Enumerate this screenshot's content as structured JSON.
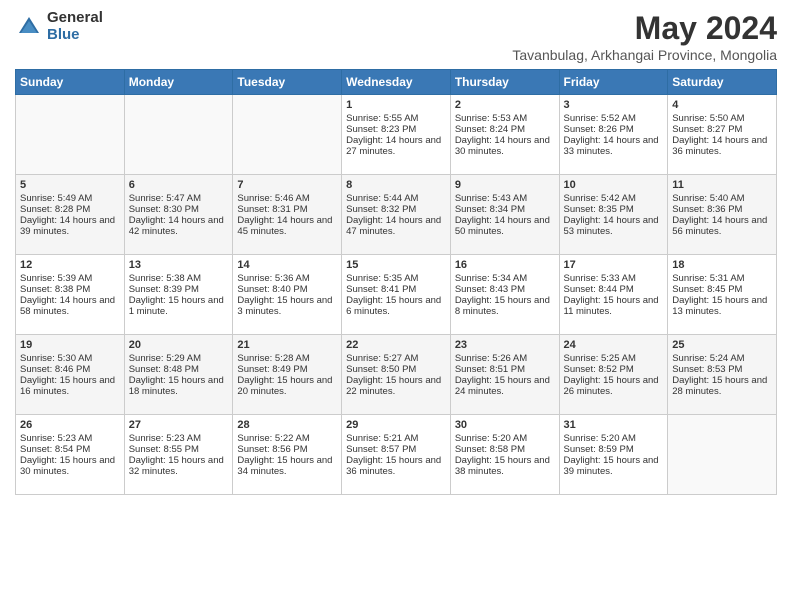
{
  "logo": {
    "general": "General",
    "blue": "Blue"
  },
  "title": "May 2024",
  "subtitle": "Tavanbulag, Arkhangai Province, Mongolia",
  "days_of_week": [
    "Sunday",
    "Monday",
    "Tuesday",
    "Wednesday",
    "Thursday",
    "Friday",
    "Saturday"
  ],
  "weeks": [
    [
      {
        "day": "",
        "info": ""
      },
      {
        "day": "",
        "info": ""
      },
      {
        "day": "",
        "info": ""
      },
      {
        "day": "1",
        "info": "Sunrise: 5:55 AM\nSunset: 8:23 PM\nDaylight: 14 hours and 27 minutes."
      },
      {
        "day": "2",
        "info": "Sunrise: 5:53 AM\nSunset: 8:24 PM\nDaylight: 14 hours and 30 minutes."
      },
      {
        "day": "3",
        "info": "Sunrise: 5:52 AM\nSunset: 8:26 PM\nDaylight: 14 hours and 33 minutes."
      },
      {
        "day": "4",
        "info": "Sunrise: 5:50 AM\nSunset: 8:27 PM\nDaylight: 14 hours and 36 minutes."
      }
    ],
    [
      {
        "day": "5",
        "info": "Sunrise: 5:49 AM\nSunset: 8:28 PM\nDaylight: 14 hours and 39 minutes."
      },
      {
        "day": "6",
        "info": "Sunrise: 5:47 AM\nSunset: 8:30 PM\nDaylight: 14 hours and 42 minutes."
      },
      {
        "day": "7",
        "info": "Sunrise: 5:46 AM\nSunset: 8:31 PM\nDaylight: 14 hours and 45 minutes."
      },
      {
        "day": "8",
        "info": "Sunrise: 5:44 AM\nSunset: 8:32 PM\nDaylight: 14 hours and 47 minutes."
      },
      {
        "day": "9",
        "info": "Sunrise: 5:43 AM\nSunset: 8:34 PM\nDaylight: 14 hours and 50 minutes."
      },
      {
        "day": "10",
        "info": "Sunrise: 5:42 AM\nSunset: 8:35 PM\nDaylight: 14 hours and 53 minutes."
      },
      {
        "day": "11",
        "info": "Sunrise: 5:40 AM\nSunset: 8:36 PM\nDaylight: 14 hours and 56 minutes."
      }
    ],
    [
      {
        "day": "12",
        "info": "Sunrise: 5:39 AM\nSunset: 8:38 PM\nDaylight: 14 hours and 58 minutes."
      },
      {
        "day": "13",
        "info": "Sunrise: 5:38 AM\nSunset: 8:39 PM\nDaylight: 15 hours and 1 minute."
      },
      {
        "day": "14",
        "info": "Sunrise: 5:36 AM\nSunset: 8:40 PM\nDaylight: 15 hours and 3 minutes."
      },
      {
        "day": "15",
        "info": "Sunrise: 5:35 AM\nSunset: 8:41 PM\nDaylight: 15 hours and 6 minutes."
      },
      {
        "day": "16",
        "info": "Sunrise: 5:34 AM\nSunset: 8:43 PM\nDaylight: 15 hours and 8 minutes."
      },
      {
        "day": "17",
        "info": "Sunrise: 5:33 AM\nSunset: 8:44 PM\nDaylight: 15 hours and 11 minutes."
      },
      {
        "day": "18",
        "info": "Sunrise: 5:31 AM\nSunset: 8:45 PM\nDaylight: 15 hours and 13 minutes."
      }
    ],
    [
      {
        "day": "19",
        "info": "Sunrise: 5:30 AM\nSunset: 8:46 PM\nDaylight: 15 hours and 16 minutes."
      },
      {
        "day": "20",
        "info": "Sunrise: 5:29 AM\nSunset: 8:48 PM\nDaylight: 15 hours and 18 minutes."
      },
      {
        "day": "21",
        "info": "Sunrise: 5:28 AM\nSunset: 8:49 PM\nDaylight: 15 hours and 20 minutes."
      },
      {
        "day": "22",
        "info": "Sunrise: 5:27 AM\nSunset: 8:50 PM\nDaylight: 15 hours and 22 minutes."
      },
      {
        "day": "23",
        "info": "Sunrise: 5:26 AM\nSunset: 8:51 PM\nDaylight: 15 hours and 24 minutes."
      },
      {
        "day": "24",
        "info": "Sunrise: 5:25 AM\nSunset: 8:52 PM\nDaylight: 15 hours and 26 minutes."
      },
      {
        "day": "25",
        "info": "Sunrise: 5:24 AM\nSunset: 8:53 PM\nDaylight: 15 hours and 28 minutes."
      }
    ],
    [
      {
        "day": "26",
        "info": "Sunrise: 5:23 AM\nSunset: 8:54 PM\nDaylight: 15 hours and 30 minutes."
      },
      {
        "day": "27",
        "info": "Sunrise: 5:23 AM\nSunset: 8:55 PM\nDaylight: 15 hours and 32 minutes."
      },
      {
        "day": "28",
        "info": "Sunrise: 5:22 AM\nSunset: 8:56 PM\nDaylight: 15 hours and 34 minutes."
      },
      {
        "day": "29",
        "info": "Sunrise: 5:21 AM\nSunset: 8:57 PM\nDaylight: 15 hours and 36 minutes."
      },
      {
        "day": "30",
        "info": "Sunrise: 5:20 AM\nSunset: 8:58 PM\nDaylight: 15 hours and 38 minutes."
      },
      {
        "day": "31",
        "info": "Sunrise: 5:20 AM\nSunset: 8:59 PM\nDaylight: 15 hours and 39 minutes."
      },
      {
        "day": "",
        "info": ""
      }
    ]
  ]
}
